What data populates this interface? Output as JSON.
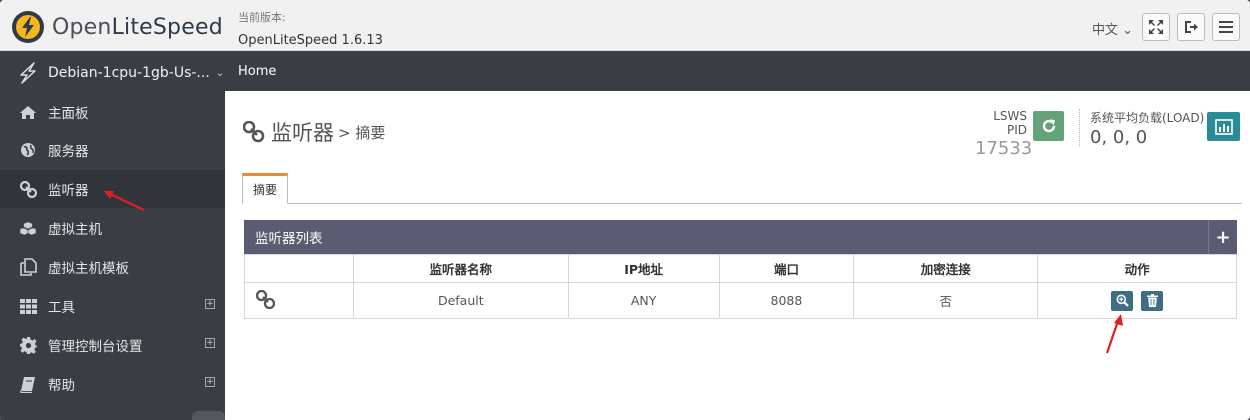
{
  "header": {
    "logo_prefix": "Open",
    "logo_brand": "LiteSpeed",
    "version_label": "当前版本:",
    "version_value": "OpenLiteSpeed 1.6.13",
    "language": "中文",
    "language_chevron": "⌄",
    "icons": [
      "fullscreen-icon",
      "logout-icon",
      "menu-icon"
    ]
  },
  "navbar": {
    "server_name": "Debian-1cpu-1gb-Us-...",
    "server_chevron": "⌄",
    "breadcrumb": "Home"
  },
  "sidebar": {
    "items": [
      {
        "label": "主面板",
        "icon": "home-icon"
      },
      {
        "label": "服务器",
        "icon": "globe-icon"
      },
      {
        "label": "监听器",
        "icon": "link-icon"
      },
      {
        "label": "虚拟主机",
        "icon": "cubes-icon"
      },
      {
        "label": "虚拟主机模板",
        "icon": "copy-icon"
      },
      {
        "label": "工具",
        "icon": "grid-icon",
        "expand": "+"
      },
      {
        "label": "管理控制台设置",
        "icon": "gear-icon",
        "expand": "+"
      },
      {
        "label": "帮助",
        "icon": "book-icon",
        "expand": "+"
      }
    ]
  },
  "main": {
    "title": "监听器",
    "subtitle": "> 摘要",
    "pid_label": "LSWS PID",
    "pid_value": "17533",
    "load_label": "系统平均负载(LOAD)",
    "load_value": "0, 0, 0",
    "tab": "摘要",
    "panel_title": "监听器列表",
    "add_label": "+",
    "columns": [
      "",
      "监听器名称",
      "IP地址",
      "端口",
      "加密连接",
      "动作"
    ],
    "rows": [
      {
        "name": "Default",
        "ip": "ANY",
        "port": "8088",
        "secure": "否"
      }
    ]
  },
  "colors": {
    "sidebar_bg": "#3b3d45",
    "panel_header": "#5a5d72",
    "refresh_green": "#64a37a",
    "chart_teal": "#2a8a95",
    "tab_accent": "#e38f34",
    "annotation_red": "#e02020"
  }
}
